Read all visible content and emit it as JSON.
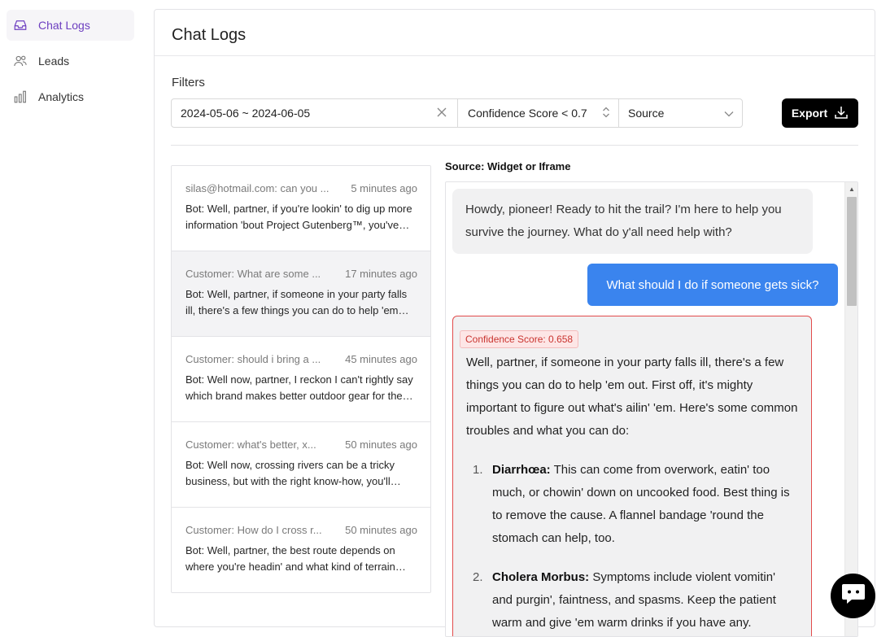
{
  "sidebar": {
    "items": [
      {
        "label": "Chat Logs",
        "icon": "inbox-icon",
        "active": true
      },
      {
        "label": "Leads",
        "icon": "users-icon",
        "active": false
      },
      {
        "label": "Analytics",
        "icon": "bar-chart-icon",
        "active": false
      }
    ]
  },
  "header": {
    "title": "Chat Logs"
  },
  "filters": {
    "label": "Filters",
    "date_range": "2024-05-06 ~ 2024-06-05",
    "confidence": "Confidence Score < 0.7",
    "source": "Source",
    "export_label": "Export"
  },
  "conversations": [
    {
      "title": "silas@hotmail.com: can you ...",
      "time": "5 minutes ago",
      "preview": "Bot: Well, partner, if you're lookin' to dig up more information 'bout Project Gutenberg™, you've come to the right place."
    },
    {
      "title": "Customer: What are some ...",
      "time": "17 minutes ago",
      "preview": "Bot: Well, partner, if someone in your party falls ill, there's a few things you can do to help 'em out."
    },
    {
      "title": "Customer: should i bring a ...",
      "time": "45 minutes ago",
      "preview": "Bot: Well now, partner, I reckon I can't rightly say which brand makes better outdoor gear for the trail."
    },
    {
      "title": "Customer: what's better, x...",
      "time": "50 minutes ago",
      "preview": "Bot: Well now, crossing rivers can be a tricky business, but with the right know-how, you'll make it across."
    },
    {
      "title": "Customer: How do I cross r...",
      "time": "50 minutes ago",
      "preview": "Bot: Well, partner, the best route depends on where you're headin' and what kind of terrain you're facin'."
    }
  ],
  "chat": {
    "source_title": "Source: Widget or Iframe",
    "greeting": "Howdy, pioneer! Ready to hit the trail? I'm here to help you survive the journey. What do y'all need help with?",
    "user_message": "What should I do if someone gets sick?",
    "confidence_badge": "Confidence Score: 0.658",
    "answer_intro": "Well, partner, if someone in your party falls ill, there's a few things you can do to help 'em out. First off, it's mighty important to figure out what's ailin' 'em. Here's some common troubles and what you can do:",
    "items": [
      {
        "num": "1.",
        "term": "Diarrhœa:",
        "text": " This can come from overwork, eatin' too much, or chowin' down on uncooked food. Best thing is to remove the cause. A flannel bandage 'round the stomach can help, too."
      },
      {
        "num": "2.",
        "term": "Cholera Morbus:",
        "text": " Symptoms include violent vomitin' and purgin', faintness, and spasms. Keep the patient warm and give 'em warm drinks if you have any."
      }
    ]
  },
  "colors": {
    "accent": "#6d3fc0",
    "user_bubble": "#3a84ee",
    "flag_border": "#e24b4b"
  }
}
